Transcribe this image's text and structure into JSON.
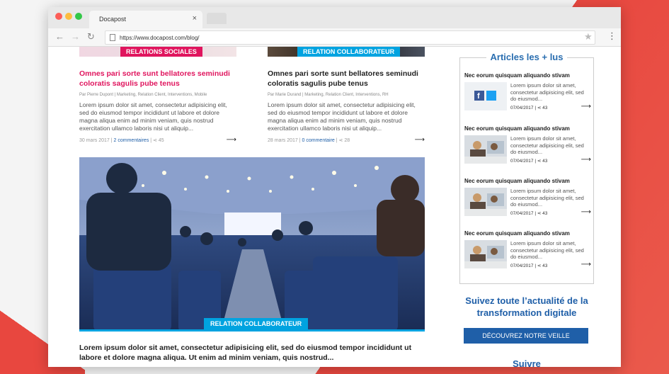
{
  "browser": {
    "tab_title": "Docapost",
    "tab_close": "×",
    "url": "https://www.docapost.com/blog/"
  },
  "icons": {
    "back": "back-arrow-icon",
    "forward": "forward-arrow-icon",
    "reload": "reload-icon",
    "bookmark": "star-icon",
    "menu": "kebab-menu-icon",
    "share": "share-icon",
    "arrow": "right-arrow-icon"
  },
  "colors": {
    "pink": "#e0155e",
    "blue_badge": "#00a3e0",
    "brand_blue": "#1f5fa8"
  },
  "articles": [
    {
      "badge": "RELATIONS SOCIALES",
      "title": "Omnes pari sorte sunt bellatores seminudi coloratis sagulis pube tenus",
      "meta": "Par Pierre Dupont | Marketing, Relation Client, Interventions, Mobile",
      "text": "Lorem ipsum dolor sit amet, consectetur adipisicing elit, sed do eiusmod tempor incididunt ut labore et dolore magna aliqua enim ad minim veniam, quis nostrud exercitation ullamco laboris nisi ut aliquip...",
      "date": "30 mars 2017",
      "comments": "2 commentaires",
      "shares": "45"
    },
    {
      "badge": "RELATION COLLABORATEUR",
      "title": "Omnes pari sorte sunt bellatores seminudi coloratis sagulis pube tenus",
      "meta": "Par Marie Durand | Marketing, Relation Client, Interventions, RH",
      "text": "Lorem ipsum dolor sit amet, consectetur adipisicing elit, sed do eiusmod tempor incididunt ut labore et dolore magna aliqua enim ad minim veniam, quis nostrud exercitation ullamco laboris nisi ut aliquip...",
      "date": "28 mars 2017",
      "comments": "0 commentaire",
      "shares": "28"
    }
  ],
  "hero": {
    "badge": "RELATION COLLABORATEUR",
    "text": "Lorem ipsum dolor sit amet, consectetur adipisicing elit, sed do eiusmod tempor incididunt ut labore et dolore magna aliqua. Ut enim ad minim veniam, quis nostrud..."
  },
  "sidebar": {
    "title": "Articles les + lus",
    "items": [
      {
        "title": "Nec eorum quisquam aliquando stivam",
        "text": "Lorem ipsum dolor sit amet, consectetur adipisicing elit, sed do eiusmod...",
        "date": "07/04/2017",
        "shares": "43"
      },
      {
        "title": "Nec eorum quisquam aliquando stivam",
        "text": "Lorem ipsum dolor sit amet, consectetur adipisicing elit, sed do eiusmod...",
        "date": "07/04/2017",
        "shares": "43"
      },
      {
        "title": "Nec eorum quisquam aliquando stivam",
        "text": "Lorem ipsum dolor sit amet, consectetur adipisicing elit, sed do eiusmod...",
        "date": "07/04/2017",
        "shares": "43"
      },
      {
        "title": "Nec eorum quisquam aliquando stivam",
        "text": "Lorem ipsum dolor sit amet, consectetur adipisicing elit, sed do eiusmod...",
        "date": "07/04/2017",
        "shares": "43"
      }
    ],
    "follow_title": "Suivez toute l’actualité de la transformation digitale",
    "cta_label": "DÉCOUVREZ NOTRE VEILLE",
    "suivre": "Suivre"
  }
}
